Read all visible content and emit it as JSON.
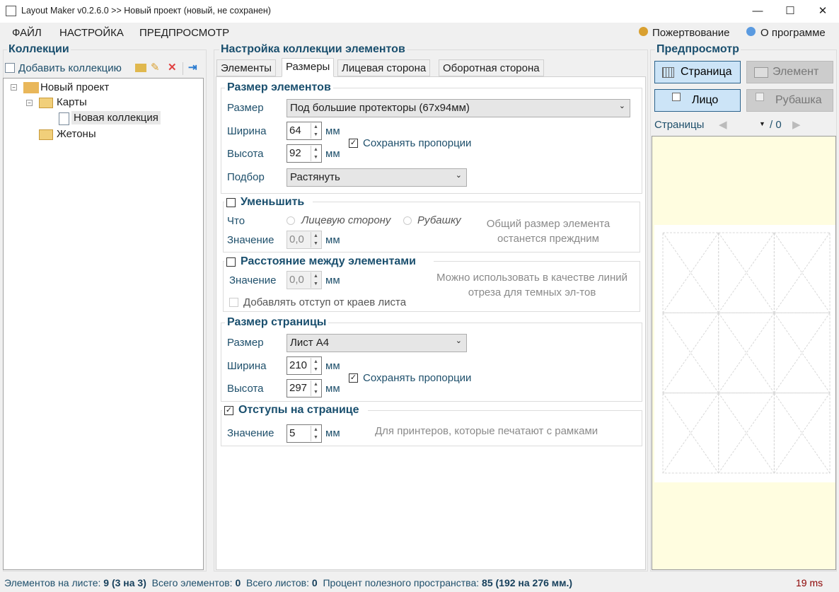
{
  "window": {
    "title": "Layout Maker v0.2.6.0 >> Новый проект (новый, не сохранен)",
    "minimize": "—",
    "maximize": "☐",
    "close": "✕"
  },
  "menu": {
    "file": "ФАЙЛ",
    "settings": "НАСТРОЙКА",
    "preview": "ПРЕДПРОСМОТР",
    "donate": "Пожертвование",
    "about": "О программе"
  },
  "collections": {
    "title": "Коллекции",
    "add": "Добавить коллекцию",
    "tree": {
      "root": "Новый проект",
      "cards": "Карты",
      "new_collection": "Новая коллекция",
      "tokens": "Жетоны"
    }
  },
  "settings": {
    "title": "Настройка коллекции элементов",
    "tabs": [
      "Элементы",
      "Размеры",
      "Лицевая сторона",
      "Оборотная сторона"
    ],
    "element_size": {
      "title": "Размер элементов",
      "size_label": "Размер",
      "size_value": "Под большие протекторы (67x94мм)",
      "width_label": "Ширина",
      "width": "64",
      "height_label": "Высота",
      "height": "92",
      "unit": "мм",
      "keep_ratio": "Сохранять пропорции",
      "fit_label": "Подбор",
      "fit_value": "Растянуть"
    },
    "shrink": {
      "title": "Уменьшить",
      "what_label": "Что",
      "face": "Лицевую сторону",
      "back": "Рубашку",
      "value_label": "Значение",
      "value": "0,0",
      "unit": "мм",
      "hint": "Общий размер элемента останется преждним"
    },
    "spacing": {
      "title": "Расстояние между элементами",
      "value_label": "Значение",
      "value": "0,0",
      "unit": "мм",
      "edge": "Добавлять отступ от краев листа",
      "hint": "Можно использовать в качестве линий отреза для темных эл-тов"
    },
    "page_size": {
      "title": "Размер страницы",
      "size_label": "Размер",
      "size_value": "Лист A4",
      "width_label": "Ширина",
      "width": "210",
      "height_label": "Высота",
      "height": "297",
      "unit": "мм",
      "keep_ratio": "Сохранять пропорции"
    },
    "margins": {
      "title": "Отступы на странице",
      "value_label": "Значение",
      "value": "5",
      "unit": "мм",
      "hint": "Для принтеров, которые печатают с рамками"
    }
  },
  "preview": {
    "title": "Предпросмотр",
    "page": "Страница",
    "element": "Элемент",
    "face": "Лицо",
    "back": "Рубашка",
    "pages_label": "Страницы",
    "pages_total": "/ 0"
  },
  "status": {
    "per_sheet_label": "Элементов на листе:",
    "per_sheet": "9 (3 на 3)",
    "total_label": "Всего элементов:",
    "total": "0",
    "sheets_label": "Всего листов:",
    "sheets": "0",
    "useful_label": "Процент полезного пространства:",
    "useful": "85 (192 на 276 мм.)",
    "time": "19 ms"
  }
}
